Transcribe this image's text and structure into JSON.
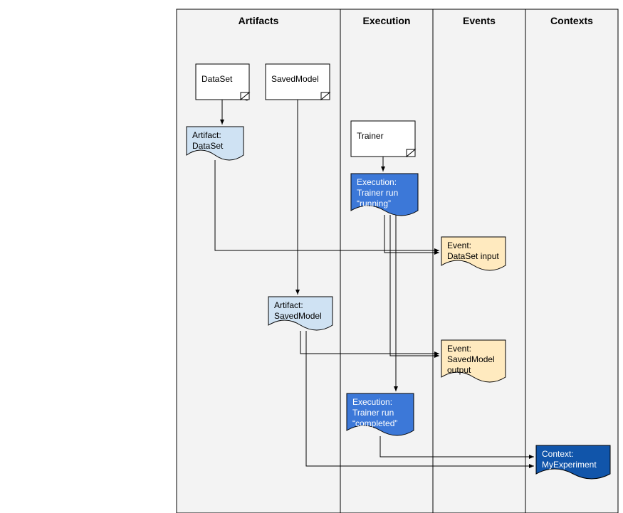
{
  "columns": {
    "artifacts": "Artifacts",
    "execution": "Execution",
    "events": "Events",
    "contexts": "Contexts"
  },
  "nodes": {
    "dataset_doc": "DataSet",
    "savedmodel_doc": "SavedModel",
    "trainer_doc": "Trainer",
    "artifact_dataset_l1": "Artifact:",
    "artifact_dataset_l2": "DataSet",
    "artifact_savedmodel_l1": "Artifact:",
    "artifact_savedmodel_l2": "SavedModel",
    "exec_running_l1": "Execution:",
    "exec_running_l2": "Trainer run",
    "exec_running_l3": "“running”",
    "exec_completed_l1": "Execution:",
    "exec_completed_l2": "Trainer run",
    "exec_completed_l3": "“completed”",
    "event_dataset_l1": "Event:",
    "event_dataset_l2": "DataSet input",
    "event_savedmodel_l1": "Event:",
    "event_savedmodel_l2": "SavedModel",
    "event_savedmodel_l3": "output",
    "context_l1": "Context:",
    "context_l2": "MyExperiment"
  },
  "colors": {
    "col_bg": "#f3f3f3",
    "artifact_fill": "#cfe2f3",
    "exec_fill": "#3c78d8",
    "event_fill": "#ffeabf",
    "context_fill": "#1155aa"
  }
}
